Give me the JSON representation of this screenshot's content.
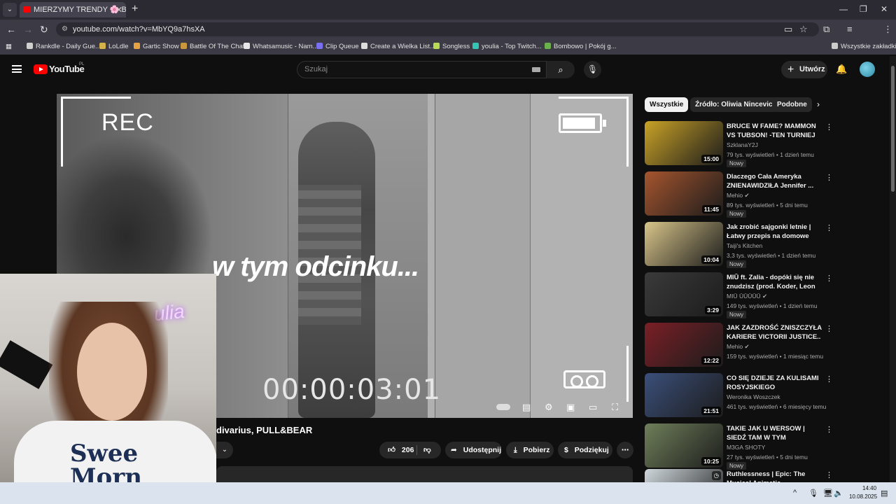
{
  "browser": {
    "tab_title": "MIERZYMY TRENDY 🌸 Bershka",
    "url": "youtube.com/watch?v=MbYQ9a7hsXA",
    "bookmarks": [
      {
        "label": "Rankdle - Daily Gue...",
        "color": "#cfcfcf"
      },
      {
        "label": "LoLdle",
        "color": "#d4b24a"
      },
      {
        "label": "Gartic Show",
        "color": "#e7a343"
      },
      {
        "label": "Battle Of The Chat",
        "color": "#c9973e"
      },
      {
        "label": "Whatsamusic - Nam...",
        "color": "#e8e8e8"
      },
      {
        "label": "Clip Queue",
        "color": "#7a6ff0"
      },
      {
        "label": "Create a Wielka List...",
        "color": "#dddddd"
      },
      {
        "label": "Songless",
        "color": "#bada55"
      },
      {
        "label": "youlia - Top Twitch...",
        "color": "#35c5b5"
      },
      {
        "label": "Bombowo | Pokój g...",
        "color": "#6ab04c"
      }
    ],
    "all_bookmarks": "Wszystkie zakładki"
  },
  "youtube": {
    "brand": "YouTube",
    "country": "PL",
    "search_placeholder": "Szukaj",
    "create_label": "Utwórz"
  },
  "player": {
    "rec": "REC",
    "overlay": "w tym odcinku...",
    "timecode": "00:00:03:01"
  },
  "video": {
    "title": "divarius, PULL&BEAR",
    "likes": "206",
    "share": "Udostępnij",
    "download": "Pobierz",
    "thanks": "Podziękuj"
  },
  "chips": [
    "Wszystkie",
    "Źródło: Oliwia Nincevic",
    "Podobne"
  ],
  "recommendations": [
    {
      "title": "BRUCE W FAME? MAMMON VS TUBSON! -TEN TURNIEJ JEST ...",
      "channel": "SzklanaY2J",
      "verified": false,
      "meta": "79 tys. wyświetleń • 1 dzień temu",
      "badge": "Nowy",
      "duration": "15:00",
      "thumb": "#c9a227"
    },
    {
      "title": "Dlaczego Cała Ameryka ZNIENAWIDZIŁA Jennifer ...",
      "channel": "Mehio",
      "verified": true,
      "meta": "89 tys. wyświetleń • 5 dni temu",
      "badge": "Nowy",
      "duration": "11:45",
      "thumb": "#a5552e"
    },
    {
      "title": "Jak zrobić sajgonki letnie | Łatwy przepis na domowe dan...",
      "channel": "Taiji's Kitchen",
      "verified": false,
      "meta": "3,3 tys. wyświetleń • 1 dzień temu",
      "badge": "Nowy",
      "duration": "10:04",
      "thumb": "#d8c58a"
    },
    {
      "title": "MIŪ ft. Zalia - dopóki się nie znudzisz (prod. Koder, Leon ...",
      "channel": "MIŪ ŪŪŪŪŪ",
      "verified": true,
      "meta": "149 tys. wyświetleń • 1 dzień temu",
      "badge": "Nowy",
      "duration": "3:29",
      "thumb": "#3a3a3a"
    },
    {
      "title": "JAK ZAZDROŚĆ ZNISZCZYŁA KARIERE VICTORII JUSTICE..",
      "channel": "Mehio",
      "verified": true,
      "meta": "159 tys. wyświetleń • 1 miesiąc temu",
      "badge": "",
      "duration": "12:22",
      "thumb": "#7a1f26"
    },
    {
      "title": "CO SIĘ DZIEJE ZA KULISAMI ROSYJSKIEGO ŁYŻWIARSTWA...",
      "channel": "Weronika Woszczek",
      "verified": false,
      "meta": "461 tys. wyświetleń • 6 miesięcy temu",
      "badge": "",
      "duration": "21:51",
      "thumb": "#3b4f7a"
    },
    {
      "title": "TAKIE JAK U WERSOW | SIEDŹ TAM W TYM POZNANIU | 😂 ...",
      "channel": "M3GA SHOTY",
      "verified": false,
      "meta": "27 tys. wyświetleń • 5 dni temu",
      "badge": "Nowy",
      "duration": "10:25",
      "thumb": "#6f7f5a"
    },
    {
      "title": "Ruthlessness | Epic: The Musical Animatic",
      "channel": "",
      "verified": false,
      "meta": "",
      "badge": "",
      "duration": "",
      "thumb": "#cfd7db"
    }
  ],
  "taskbar": {
    "time": "14:40",
    "date": "10.08.2025"
  }
}
